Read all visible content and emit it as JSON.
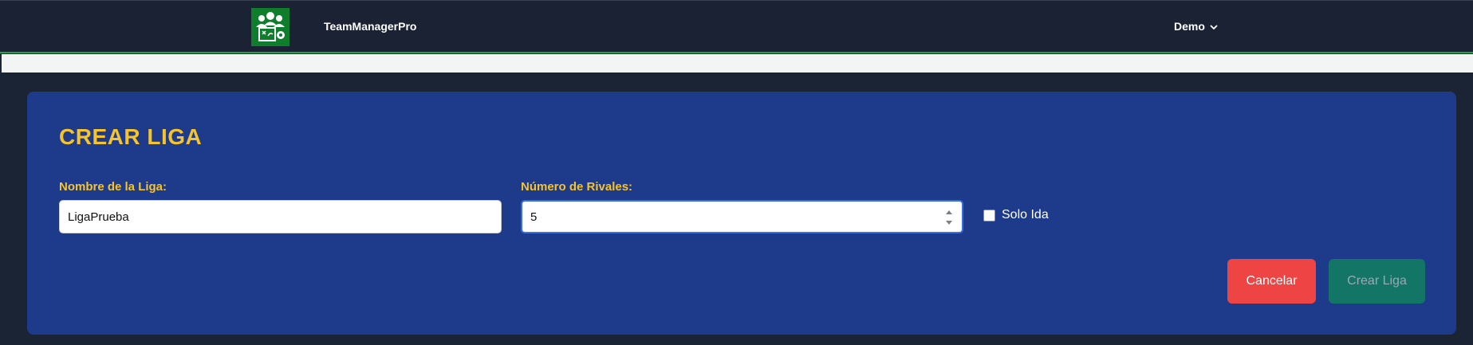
{
  "header": {
    "brand": "TeamManagerPro",
    "user_menu_label": "Demo"
  },
  "form": {
    "title": "CREAR LIGA",
    "league_name_label": "Nombre de la Liga:",
    "league_name_value": "LigaPrueba",
    "rivals_label": "Número de Rivales:",
    "rivals_value": "5",
    "solo_ida_label": "Solo Ida",
    "solo_ida_checked": false,
    "cancel_label": "Cancelar",
    "create_label": "Crear Liga"
  },
  "colors": {
    "accent_yellow": "#f5c32c",
    "card_blue": "#1e3a8a",
    "cancel_red": "#ef4444",
    "create_teal": "#137566",
    "logo_green": "#0e7d2c"
  },
  "icons": {
    "logo": "team-tactics-logo-icon",
    "user_menu": "chevron-down-icon",
    "rivals_spinner": "spinner-arrows-icon"
  }
}
